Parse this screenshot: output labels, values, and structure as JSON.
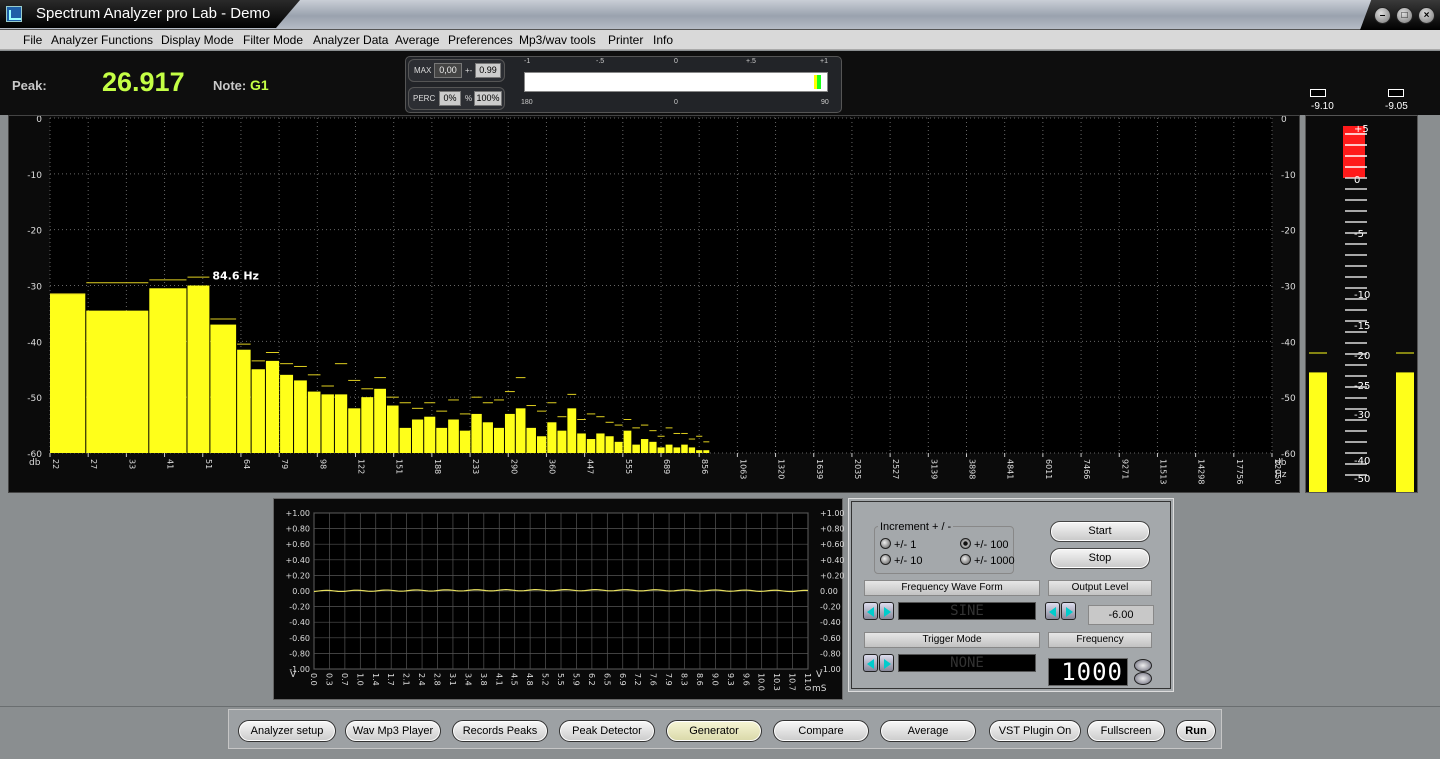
{
  "window": {
    "title": "Spectrum Analyzer pro Lab - Demo"
  },
  "menu": [
    "File",
    "Analyzer Functions",
    "Display Mode",
    "Filter Mode",
    "Analyzer Data",
    "Average",
    "Preferences",
    "Mp3/wav tools",
    "Printer",
    "Info"
  ],
  "peak": {
    "label": "Peak:",
    "value": "26.917",
    "note_label": "Note:",
    "note_value": "G1"
  },
  "meter": {
    "max_label": "MAX",
    "max_value": "0,00",
    "pm_label": "+-",
    "pm_value": "0.99",
    "perc_label": "PERC",
    "perc_value": "0%",
    "pct_sign": "%",
    "perc_full": "100%",
    "scale_top": [
      "-1",
      "-.5",
      "0",
      "+.5",
      "+1"
    ],
    "scale_bottom": [
      "180",
      "0",
      "90"
    ],
    "level": 0.95
  },
  "level_readouts": {
    "left": "-9.10",
    "right": "-9.05"
  },
  "colors": {
    "bar": "#ffff1a",
    "peak_line": "#e0d020",
    "accent_green": "#c4ff45",
    "meter_red": "#ff1a1a"
  },
  "spectrum": {
    "y_ticks": [
      "0",
      "-10",
      "-20",
      "-30",
      "-40",
      "-50",
      "-60"
    ],
    "y_unit": "db",
    "x_unit": "Hz",
    "x_ticks": [
      "22",
      "27",
      "33",
      "41",
      "51",
      "64",
      "79",
      "98",
      "122",
      "151",
      "188",
      "233",
      "290",
      "360",
      "447",
      "555",
      "689",
      "856",
      "1063",
      "1320",
      "1639",
      "2035",
      "2527",
      "3139",
      "3898",
      "4841",
      "6011",
      "7466",
      "9271",
      "11513",
      "14298",
      "17756",
      "22050"
    ],
    "peak_label": "84.6 Hz",
    "bars": [
      {
        "db": -31.5,
        "peak": -31.5
      },
      {
        "db": -34.5,
        "peak": -29.5
      },
      {
        "db": -30.5,
        "peak": -29.0
      },
      {
        "db": -30.0,
        "peak": -28.5
      },
      {
        "db": -37.0,
        "peak": -36.0
      },
      {
        "db": -41.5,
        "peak": -40.5
      },
      {
        "db": -45.0,
        "peak": -43.5
      },
      {
        "db": -43.5,
        "peak": -42.0
      },
      {
        "db": -46.0,
        "peak": -44.0
      },
      {
        "db": -47.0,
        "peak": -44.5
      },
      {
        "db": -49.0,
        "peak": -46.0
      },
      {
        "db": -49.5,
        "peak": -48.0
      },
      {
        "db": -49.5,
        "peak": -44.0
      },
      {
        "db": -52.0,
        "peak": -47.0
      },
      {
        "db": -50.0,
        "peak": -48.5
      },
      {
        "db": -48.5,
        "peak": -46.5
      },
      {
        "db": -51.5,
        "peak": -50.0
      },
      {
        "db": -55.5,
        "peak": -51.0
      },
      {
        "db": -54.0,
        "peak": -52.0
      },
      {
        "db": -53.5,
        "peak": -51.0
      },
      {
        "db": -55.5,
        "peak": -52.5
      },
      {
        "db": -54.0,
        "peak": -50.5
      },
      {
        "db": -56.0,
        "peak": -53.0
      },
      {
        "db": -53.0,
        "peak": -50.0
      },
      {
        "db": -54.5,
        "peak": -51.0
      },
      {
        "db": -55.5,
        "peak": -50.5
      },
      {
        "db": -53.0,
        "peak": -49.0
      },
      {
        "db": -52.0,
        "peak": -46.5
      },
      {
        "db": -55.5,
        "peak": -51.5
      },
      {
        "db": -57.0,
        "peak": -52.5
      },
      {
        "db": -54.5,
        "peak": -51.0
      },
      {
        "db": -56.0,
        "peak": -53.5
      },
      {
        "db": -52.0,
        "peak": -49.5
      },
      {
        "db": -56.5,
        "peak": -54.0
      },
      {
        "db": -57.5,
        "peak": -53.0
      },
      {
        "db": -56.5,
        "peak": -53.5
      },
      {
        "db": -57.0,
        "peak": -54.5
      },
      {
        "db": -58.0,
        "peak": -55.0
      },
      {
        "db": -56.0,
        "peak": -54.0
      },
      {
        "db": -58.5,
        "peak": -55.5
      },
      {
        "db": -57.5,
        "peak": -55.0
      },
      {
        "db": -58.0,
        "peak": -56.0
      },
      {
        "db": -59.0,
        "peak": -57.0
      },
      {
        "db": -58.5,
        "peak": -55.5
      },
      {
        "db": -59.0,
        "peak": -56.5
      },
      {
        "db": -58.5,
        "peak": -56.5
      },
      {
        "db": -59.0,
        "peak": -57.5
      },
      {
        "db": -59.5,
        "peak": -57.0
      },
      {
        "db": -59.5,
        "peak": -58.0
      }
    ]
  },
  "level_meter": {
    "labels": [
      "+5",
      "0",
      "-5",
      "-10",
      "-15",
      "-20",
      "-25",
      "-30",
      "-40",
      "-50"
    ],
    "left_level": 0.325,
    "right_level": 0.325
  },
  "scope": {
    "y_labels": [
      "+1.00",
      "+0.80",
      "+0.60",
      "+0.40",
      "+0.20",
      "0.00",
      "-0.20",
      "-0.40",
      "-0.60",
      "-0.80",
      "-1.00"
    ],
    "y_unit": "V",
    "x_labels": [
      "0.0",
      "0.3",
      "0.7",
      "1.0",
      "1.4",
      "1.7",
      "2.1",
      "2.4",
      "2.8",
      "3.1",
      "3.4",
      "3.8",
      "4.1",
      "4.5",
      "4.8",
      "5.2",
      "5.5",
      "5.9",
      "6.2",
      "6.5",
      "6.9",
      "7.2",
      "7.6",
      "7.9",
      "8.3",
      "8.6",
      "9.0",
      "9.3",
      "9.6",
      "10.0",
      "10.3",
      "10.7",
      "11.0"
    ],
    "x_unit": "mS"
  },
  "generator": {
    "increment_title": "Increment + / -",
    "increments": [
      {
        "label": "+/- 1",
        "selected": false
      },
      {
        "label": "+/- 100",
        "selected": true
      },
      {
        "label": "+/- 10",
        "selected": false
      },
      {
        "label": "+/- 1000",
        "selected": false
      }
    ],
    "start_label": "Start",
    "stop_label": "Stop",
    "wave_form_header": "Frequency Wave Form",
    "wave_form_value": "SINE",
    "output_level_header": "Output Level",
    "output_level_value": "-6.00",
    "trigger_header": "Trigger Mode",
    "trigger_value": "NONE",
    "frequency_header": "Frequency",
    "frequency_value": "1000"
  },
  "bottom_buttons": [
    "Analyzer setup",
    "Wav Mp3 Player",
    "Records Peaks",
    "Peak Detector",
    "Generator",
    "Compare",
    "Average",
    "VST Plugin On",
    "Fullscreen",
    "Run"
  ],
  "active_bottom_button": "Generator"
}
